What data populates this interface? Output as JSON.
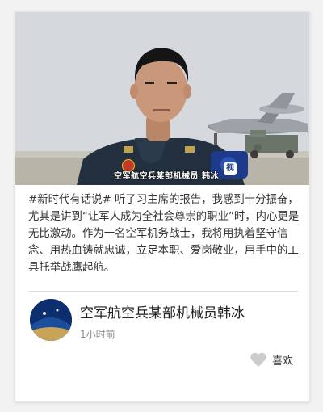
{
  "post": {
    "video": {
      "caption": "空军航空兵某部机械员 韩冰",
      "badge_label": "视"
    },
    "text": "#新时代有话说# 听了习主席的报告，我感到十分振奋，尤其是讲到“让军人成为全社会尊崇的职业”时，内心更是无比激动。作为一名空军机务战士，我将用执着坚守信念、用热血铸就忠诚，立足本职、爱岗敬业，用手中的工具托举战鹰起航。",
    "author": "空军航空兵某部机械员韩冰",
    "time": "1小时前",
    "like_label": "喜欢"
  },
  "colors": {
    "card_background": "#ffffff",
    "page_background": "#f2f2f2",
    "text": "#333333",
    "muted_text": "#888888",
    "like_icon": "#cccccc"
  },
  "icons": [
    "heart-icon",
    "unit-emblem-icon",
    "media-badge-icon"
  ]
}
